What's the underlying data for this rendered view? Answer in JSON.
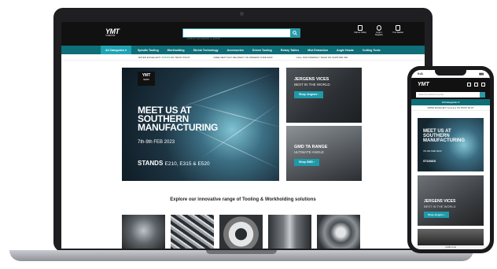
{
  "site": {
    "logo": "YMT",
    "logo_sub": "YAMATO",
    "search_placeholder": "Search products & parts",
    "header_icons": [
      {
        "label": "Call us Today",
        "icon": "phone-icon"
      },
      {
        "label": "Login / Register",
        "icon": "user-icon"
      },
      {
        "label": "Your Basket",
        "icon": "basket-icon"
      }
    ],
    "nav": {
      "all_categories": "All Categories",
      "items": [
        "Spindle Tooling",
        "Workholding",
        "Shrink Technology",
        "Accessories",
        "Driven Tooling",
        "Rotary Tables",
        "Mist Extraction",
        "Angle Heads",
        "Cutting Tools"
      ]
    },
    "usp": [
      {
        "text": "RATED EXCELLENT",
        "stars": "★★★★★",
        "suffix": "ON TRUST PILOT"
      },
      {
        "text": "FREE NEXT DAY DELIVERY ON ORDERS OVER £200"
      },
      {
        "text": "CALL OUR FRIENDLY TEAM ON 01455 890 000"
      }
    ]
  },
  "hero": {
    "badge": "YMT",
    "badge_sub": "NEWS",
    "headline": "MEET US AT SOUTHERN MANUFACTURING",
    "date": "7th-9th FEB 2023",
    "stands_label": "STANDS",
    "stands_numbers": "E210, E315 & E520"
  },
  "tiles": [
    {
      "title": "JERGENS VICES",
      "subtitle": "BEST IN THE WORLD",
      "button": "Shop Jergens"
    },
    {
      "title": "GMD TA RANGE",
      "subtitle": "ULTIMATE ANGLE",
      "button": "Shop GMD"
    }
  ],
  "explore_heading": "Explore our innovative range of Tooling & Workholding solutions",
  "phone": {
    "time": "9:41",
    "logo": "YMT",
    "search_placeholder": "Search products & parts",
    "all_categories": "All Categories",
    "usp": "RATED EXCELLENT ★★★★★ ON TRUST PILOT",
    "hero_headline": "MEET US AT SOUTHERN MANUFACTURING",
    "hero_date": "7th-9th FEB 2023",
    "hero_stands": "STANDS",
    "card_title": "JERGENS VICES",
    "card_subtitle": "BEST IN THE WORLD",
    "card_button": "Shop Jergens",
    "url": "ymtltd.co.uk"
  }
}
